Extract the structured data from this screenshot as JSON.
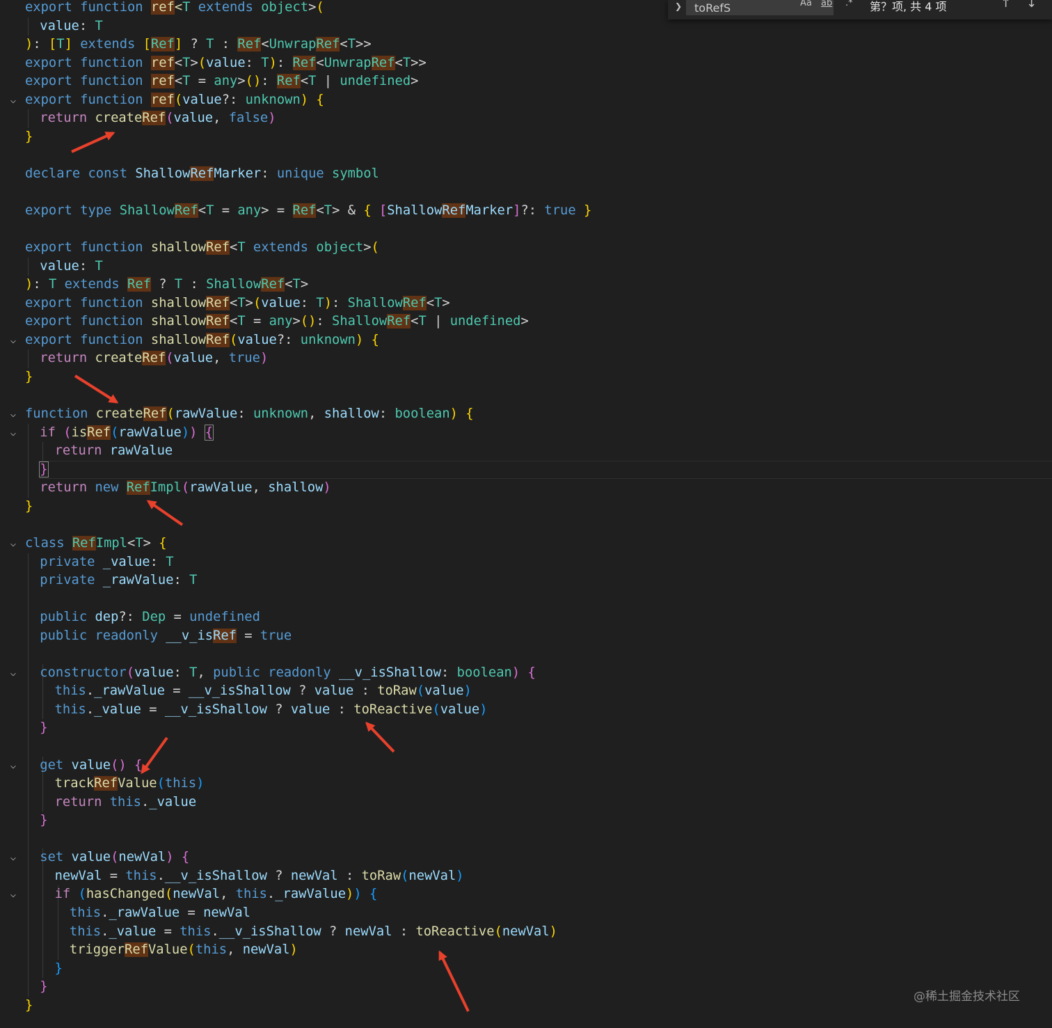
{
  "find_widget": {
    "query": "toRefS",
    "match_case_label": "Aa",
    "whole_word_label": "ab",
    "regex_label": ".*",
    "result_text": "第？项, 共 4 项",
    "prev_label": "↑",
    "next_label": "↓"
  },
  "watermark": "@稀土掘金技术社区",
  "colors": {
    "editor_background": "#1f1f1f",
    "match_highlight": "#613214",
    "keyword": "#569cd6",
    "control_keyword": "#c586c0",
    "function": "#dcdcaa",
    "type": "#4ec9b0",
    "variable": "#9cdcfe",
    "annotation_arrow": "#e8412c"
  },
  "code_lines": [
    [
      [
        "export ",
        "kw"
      ],
      [
        "function ",
        "kw"
      ],
      [
        "ref",
        "fn hl"
      ],
      [
        "<",
        "fn"
      ],
      [
        "T",
        "ty"
      ],
      [
        " extends ",
        "kw"
      ],
      [
        "object",
        "ty"
      ],
      [
        ">",
        ""
      ],
      [
        "(",
        "br1"
      ]
    ],
    [
      [
        "value",
        "vr"
      ],
      [
        ": ",
        ""
      ],
      [
        "T",
        "ty"
      ]
    ],
    [
      [
        ")",
        "br1"
      ],
      [
        ": ",
        ""
      ],
      [
        "[",
        "br1"
      ],
      [
        "T",
        "ty"
      ],
      [
        "] ",
        "br1"
      ],
      [
        "extends ",
        "kw"
      ],
      [
        "[",
        "br1"
      ],
      [
        "Ref",
        "ty hl"
      ],
      [
        "] ",
        "br1"
      ],
      [
        "? ",
        ""
      ],
      [
        "T ",
        "ty"
      ],
      [
        ": ",
        ""
      ],
      [
        "Ref",
        "ty hl"
      ],
      [
        "<",
        ""
      ],
      [
        "Unwrap",
        "ty"
      ],
      [
        "Ref",
        "ty hl"
      ],
      [
        "<",
        ""
      ],
      [
        "T",
        "ty"
      ],
      [
        ">>",
        ""
      ]
    ],
    [
      [
        "export ",
        "kw"
      ],
      [
        "function ",
        "kw"
      ],
      [
        "ref",
        "fn hl"
      ],
      [
        "<",
        ""
      ],
      [
        "T",
        "ty"
      ],
      [
        ">",
        ""
      ],
      [
        "(",
        "br1"
      ],
      [
        "value",
        "vr"
      ],
      [
        ": ",
        ""
      ],
      [
        "T",
        "ty"
      ],
      [
        ")",
        "br1"
      ],
      [
        ": ",
        ""
      ],
      [
        "Ref",
        "ty hl"
      ],
      [
        "<",
        ""
      ],
      [
        "Unwrap",
        "ty"
      ],
      [
        "Ref",
        "ty hl"
      ],
      [
        "<",
        ""
      ],
      [
        "T",
        "ty"
      ],
      [
        ">>",
        ""
      ]
    ],
    [
      [
        "export ",
        "kw"
      ],
      [
        "function ",
        "kw"
      ],
      [
        "ref",
        "fn hl"
      ],
      [
        "<",
        ""
      ],
      [
        "T ",
        "ty"
      ],
      [
        "= ",
        ""
      ],
      [
        "any",
        "ty"
      ],
      [
        ">",
        ""
      ],
      [
        "()",
        "br1"
      ],
      [
        ": ",
        ""
      ],
      [
        "Ref",
        "ty hl"
      ],
      [
        "<",
        ""
      ],
      [
        "T ",
        "ty"
      ],
      [
        "| ",
        ""
      ],
      [
        "undefined",
        "ty"
      ],
      [
        ">",
        ""
      ]
    ],
    [
      [
        "export ",
        "kw"
      ],
      [
        "function ",
        "kw"
      ],
      [
        "ref",
        "fn hl"
      ],
      [
        "(",
        "br1"
      ],
      [
        "value",
        "vr"
      ],
      [
        "?: ",
        ""
      ],
      [
        "unknown",
        "ty"
      ],
      [
        ") ",
        "br1"
      ],
      [
        "{",
        "br1"
      ]
    ],
    [
      [
        "return ",
        "ctl"
      ],
      [
        "create",
        "fn"
      ],
      [
        "Ref",
        "fn hl"
      ],
      [
        "(",
        "br2"
      ],
      [
        "value",
        "vr"
      ],
      [
        ", ",
        ""
      ],
      [
        "false",
        "kw"
      ],
      [
        ")",
        "br2"
      ]
    ],
    [
      [
        "}",
        "br1"
      ]
    ],
    [],
    [
      [
        "declare ",
        "kw"
      ],
      [
        "const ",
        "kw"
      ],
      [
        "Shallow",
        "vr"
      ],
      [
        "Ref",
        "vr hl"
      ],
      [
        "Marker",
        "vr"
      ],
      [
        ": ",
        ""
      ],
      [
        "unique ",
        "kw"
      ],
      [
        "symbol",
        "ty"
      ]
    ],
    [],
    [
      [
        "export ",
        "kw"
      ],
      [
        "type ",
        "kw"
      ],
      [
        "Shallow",
        "ty"
      ],
      [
        "Ref",
        "ty hl"
      ],
      [
        "<",
        ""
      ],
      [
        "T ",
        "ty"
      ],
      [
        "= ",
        ""
      ],
      [
        "any",
        "ty"
      ],
      [
        "> ",
        ""
      ],
      [
        "= ",
        ""
      ],
      [
        "Ref",
        "ty hl"
      ],
      [
        "<",
        ""
      ],
      [
        "T",
        "ty"
      ],
      [
        "> ",
        ""
      ],
      [
        "& ",
        ""
      ],
      [
        "{ ",
        "br1"
      ],
      [
        "[",
        "br2"
      ],
      [
        "Shallow",
        "vr"
      ],
      [
        "Ref",
        "vr hl"
      ],
      [
        "Marker",
        "vr"
      ],
      [
        "]",
        "br2"
      ],
      [
        "?: ",
        ""
      ],
      [
        "true ",
        "kw"
      ],
      [
        "}",
        "br1"
      ]
    ],
    [],
    [
      [
        "export ",
        "kw"
      ],
      [
        "function ",
        "kw"
      ],
      [
        "shallow",
        "fn"
      ],
      [
        "Ref",
        "fn hl"
      ],
      [
        "<",
        ""
      ],
      [
        "T",
        "ty"
      ],
      [
        " extends ",
        "kw"
      ],
      [
        "object",
        "ty"
      ],
      [
        ">",
        ""
      ],
      [
        "(",
        "br1"
      ]
    ],
    [
      [
        "value",
        "vr"
      ],
      [
        ": ",
        ""
      ],
      [
        "T",
        "ty"
      ]
    ],
    [
      [
        ")",
        "br1"
      ],
      [
        ": ",
        ""
      ],
      [
        "T ",
        "ty"
      ],
      [
        "extends ",
        "kw"
      ],
      [
        "Ref",
        "ty hl"
      ],
      [
        " ? ",
        ""
      ],
      [
        "T ",
        "ty"
      ],
      [
        ": ",
        ""
      ],
      [
        "Shallow",
        "ty"
      ],
      [
        "Ref",
        "ty hl"
      ],
      [
        "<",
        ""
      ],
      [
        "T",
        "ty"
      ],
      [
        ">",
        ""
      ]
    ],
    [
      [
        "export ",
        "kw"
      ],
      [
        "function ",
        "kw"
      ],
      [
        "shallow",
        "fn"
      ],
      [
        "Ref",
        "fn hl"
      ],
      [
        "<",
        ""
      ],
      [
        "T",
        "ty"
      ],
      [
        ">",
        ""
      ],
      [
        "(",
        "br1"
      ],
      [
        "value",
        "vr"
      ],
      [
        ": ",
        ""
      ],
      [
        "T",
        "ty"
      ],
      [
        ")",
        "br1"
      ],
      [
        ": ",
        ""
      ],
      [
        "Shallow",
        "ty"
      ],
      [
        "Ref",
        "ty hl"
      ],
      [
        "<",
        ""
      ],
      [
        "T",
        "ty"
      ],
      [
        ">",
        ""
      ]
    ],
    [
      [
        "export ",
        "kw"
      ],
      [
        "function ",
        "kw"
      ],
      [
        "shallow",
        "fn"
      ],
      [
        "Ref",
        "fn hl"
      ],
      [
        "<",
        ""
      ],
      [
        "T ",
        "ty"
      ],
      [
        "= ",
        ""
      ],
      [
        "any",
        "ty"
      ],
      [
        ">",
        ""
      ],
      [
        "()",
        "br1"
      ],
      [
        ": ",
        ""
      ],
      [
        "Shallow",
        "ty"
      ],
      [
        "Ref",
        "ty hl"
      ],
      [
        "<",
        ""
      ],
      [
        "T ",
        "ty"
      ],
      [
        "| ",
        ""
      ],
      [
        "undefined",
        "ty"
      ],
      [
        ">",
        ""
      ]
    ],
    [
      [
        "export ",
        "kw"
      ],
      [
        "function ",
        "kw"
      ],
      [
        "shallow",
        "fn"
      ],
      [
        "Ref",
        "fn hl"
      ],
      [
        "(",
        "br1"
      ],
      [
        "value",
        "vr"
      ],
      [
        "?: ",
        ""
      ],
      [
        "unknown",
        "ty"
      ],
      [
        ") ",
        "br1"
      ],
      [
        "{",
        "br1"
      ]
    ],
    [
      [
        "return ",
        "ctl"
      ],
      [
        "create",
        "fn"
      ],
      [
        "Ref",
        "fn hl"
      ],
      [
        "(",
        "br2"
      ],
      [
        "value",
        "vr"
      ],
      [
        ", ",
        ""
      ],
      [
        "true",
        "kw"
      ],
      [
        ")",
        "br2"
      ]
    ],
    [
      [
        "}",
        "br1"
      ]
    ],
    [],
    [
      [
        "function ",
        "kw"
      ],
      [
        "create",
        "fn"
      ],
      [
        "Ref",
        "fn hl"
      ],
      [
        "(",
        "br1"
      ],
      [
        "rawValue",
        "vr"
      ],
      [
        ": ",
        ""
      ],
      [
        "unknown",
        "ty"
      ],
      [
        ", ",
        ""
      ],
      [
        "shallow",
        "vr"
      ],
      [
        ": ",
        ""
      ],
      [
        "boolean",
        "ty"
      ],
      [
        ") ",
        "br1"
      ],
      [
        "{",
        "br1"
      ]
    ],
    [
      [
        "if ",
        "ctl"
      ],
      [
        "(",
        "br2"
      ],
      [
        "is",
        "fn"
      ],
      [
        "Ref",
        "fn hl"
      ],
      [
        "(",
        "br3"
      ],
      [
        "rawValue",
        "vr"
      ],
      [
        ")",
        "br3"
      ],
      [
        ") ",
        "br2"
      ],
      [
        "{",
        "br2 bm"
      ]
    ],
    [
      [
        "return ",
        "ctl"
      ],
      [
        "rawValue",
        "vr"
      ]
    ],
    [
      [
        "}",
        "br2 bm"
      ]
    ],
    [
      [
        "return ",
        "ctl"
      ],
      [
        "new ",
        "kw"
      ],
      [
        "Ref",
        "ty hl"
      ],
      [
        "Impl",
        "ty"
      ],
      [
        "(",
        "br2"
      ],
      [
        "rawValue",
        "vr"
      ],
      [
        ", ",
        ""
      ],
      [
        "shallow",
        "vr"
      ],
      [
        ")",
        "br2"
      ]
    ],
    [
      [
        "}",
        "br1"
      ]
    ],
    [],
    [
      [
        "class ",
        "kw"
      ],
      [
        "Ref",
        "ty hl"
      ],
      [
        "Impl",
        "ty"
      ],
      [
        "<",
        ""
      ],
      [
        "T",
        "ty"
      ],
      [
        "> ",
        ""
      ],
      [
        "{",
        "br1"
      ]
    ],
    [
      [
        "private ",
        "kw"
      ],
      [
        "_value",
        "vr"
      ],
      [
        ": ",
        ""
      ],
      [
        "T",
        "ty"
      ]
    ],
    [
      [
        "private ",
        "kw"
      ],
      [
        "_rawValue",
        "vr"
      ],
      [
        ": ",
        ""
      ],
      [
        "T",
        "ty"
      ]
    ],
    [],
    [
      [
        "public ",
        "kw"
      ],
      [
        "dep",
        "vr"
      ],
      [
        "?: ",
        ""
      ],
      [
        "Dep ",
        "ty"
      ],
      [
        "= ",
        ""
      ],
      [
        "undefined",
        "kw"
      ]
    ],
    [
      [
        "public ",
        "kw"
      ],
      [
        "readonly ",
        "kw"
      ],
      [
        "__v_is",
        "vr"
      ],
      [
        "Ref",
        "vr hl"
      ],
      [
        " = ",
        ""
      ],
      [
        "true",
        "kw"
      ]
    ],
    [],
    [
      [
        "constructor",
        "kw"
      ],
      [
        "(",
        "br2"
      ],
      [
        "value",
        "vr"
      ],
      [
        ": ",
        ""
      ],
      [
        "T",
        "ty"
      ],
      [
        ", ",
        ""
      ],
      [
        "public ",
        "kw"
      ],
      [
        "readonly ",
        "kw"
      ],
      [
        "__v_isShallow",
        "vr"
      ],
      [
        ": ",
        ""
      ],
      [
        "boolean",
        "ty"
      ],
      [
        ") ",
        "br2"
      ],
      [
        "{",
        "br2"
      ]
    ],
    [
      [
        "this",
        "kw"
      ],
      [
        ".",
        ""
      ],
      [
        "_rawValue",
        "vr"
      ],
      [
        " = ",
        ""
      ],
      [
        "__v_isShallow",
        "vr"
      ],
      [
        " ? ",
        ""
      ],
      [
        "value",
        "vr"
      ],
      [
        " : ",
        ""
      ],
      [
        "toRaw",
        "fn"
      ],
      [
        "(",
        "br3"
      ],
      [
        "value",
        "vr"
      ],
      [
        ")",
        "br3"
      ]
    ],
    [
      [
        "this",
        "kw"
      ],
      [
        ".",
        ""
      ],
      [
        "_value",
        "vr"
      ],
      [
        " = ",
        ""
      ],
      [
        "__v_isShallow",
        "vr"
      ],
      [
        " ? ",
        ""
      ],
      [
        "value",
        "vr"
      ],
      [
        " : ",
        ""
      ],
      [
        "toReactive",
        "fn"
      ],
      [
        "(",
        "br3"
      ],
      [
        "value",
        "vr"
      ],
      [
        ")",
        "br3"
      ]
    ],
    [
      [
        "}",
        "br2"
      ]
    ],
    [],
    [
      [
        "get ",
        "kw"
      ],
      [
        "value",
        "vr"
      ],
      [
        "() ",
        "br2"
      ],
      [
        "{",
        "br2"
      ]
    ],
    [
      [
        "track",
        "fn"
      ],
      [
        "Ref",
        "fn hl"
      ],
      [
        "Value",
        "fn"
      ],
      [
        "(",
        "br3"
      ],
      [
        "this",
        "kw"
      ],
      [
        ")",
        "br3"
      ]
    ],
    [
      [
        "return ",
        "ctl"
      ],
      [
        "this",
        "kw"
      ],
      [
        ".",
        ""
      ],
      [
        "_value",
        "vr"
      ]
    ],
    [
      [
        "}",
        "br2"
      ]
    ],
    [],
    [
      [
        "set ",
        "kw"
      ],
      [
        "value",
        "vr"
      ],
      [
        "(",
        "br2"
      ],
      [
        "newVal",
        "vr"
      ],
      [
        ") ",
        "br2"
      ],
      [
        "{",
        "br2"
      ]
    ],
    [
      [
        "newVal",
        "vr"
      ],
      [
        " = ",
        ""
      ],
      [
        "this",
        "kw"
      ],
      [
        ".",
        ""
      ],
      [
        "__v_isShallow",
        "vr"
      ],
      [
        " ? ",
        ""
      ],
      [
        "newVal",
        "vr"
      ],
      [
        " : ",
        ""
      ],
      [
        "toRaw",
        "fn"
      ],
      [
        "(",
        "br3"
      ],
      [
        "newVal",
        "vr"
      ],
      [
        ")",
        "br3"
      ]
    ],
    [
      [
        "if ",
        "ctl"
      ],
      [
        "(",
        "br3"
      ],
      [
        "hasChanged",
        "fn"
      ],
      [
        "(",
        "br1"
      ],
      [
        "newVal",
        "vr"
      ],
      [
        ", ",
        ""
      ],
      [
        "this",
        "kw"
      ],
      [
        ".",
        ""
      ],
      [
        "_rawValue",
        "vr"
      ],
      [
        ")",
        "br1"
      ],
      [
        ") ",
        "br3"
      ],
      [
        "{",
        "br3"
      ]
    ],
    [
      [
        "this",
        "kw"
      ],
      [
        ".",
        ""
      ],
      [
        "_rawValue",
        "vr"
      ],
      [
        " = ",
        ""
      ],
      [
        "newVal",
        "vr"
      ]
    ],
    [
      [
        "this",
        "kw"
      ],
      [
        ".",
        ""
      ],
      [
        "_value",
        "vr"
      ],
      [
        " = ",
        ""
      ],
      [
        "this",
        "kw"
      ],
      [
        ".",
        ""
      ],
      [
        "__v_isShallow",
        "vr"
      ],
      [
        " ? ",
        ""
      ],
      [
        "newVal",
        "vr"
      ],
      [
        " : ",
        ""
      ],
      [
        "toReactive",
        "fn"
      ],
      [
        "(",
        "br1"
      ],
      [
        "newVal",
        "vr"
      ],
      [
        ")",
        "br1"
      ]
    ],
    [
      [
        "trigger",
        "fn"
      ],
      [
        "Ref",
        "fn hl"
      ],
      [
        "Value",
        "fn"
      ],
      [
        "(",
        "br1"
      ],
      [
        "this",
        "kw"
      ],
      [
        ", ",
        ""
      ],
      [
        "newVal",
        "vr"
      ],
      [
        ")",
        "br1"
      ]
    ],
    [
      [
        "}",
        "br3"
      ]
    ],
    [
      [
        "}",
        "br2"
      ]
    ],
    [
      [
        "}",
        "br1"
      ]
    ]
  ]
}
